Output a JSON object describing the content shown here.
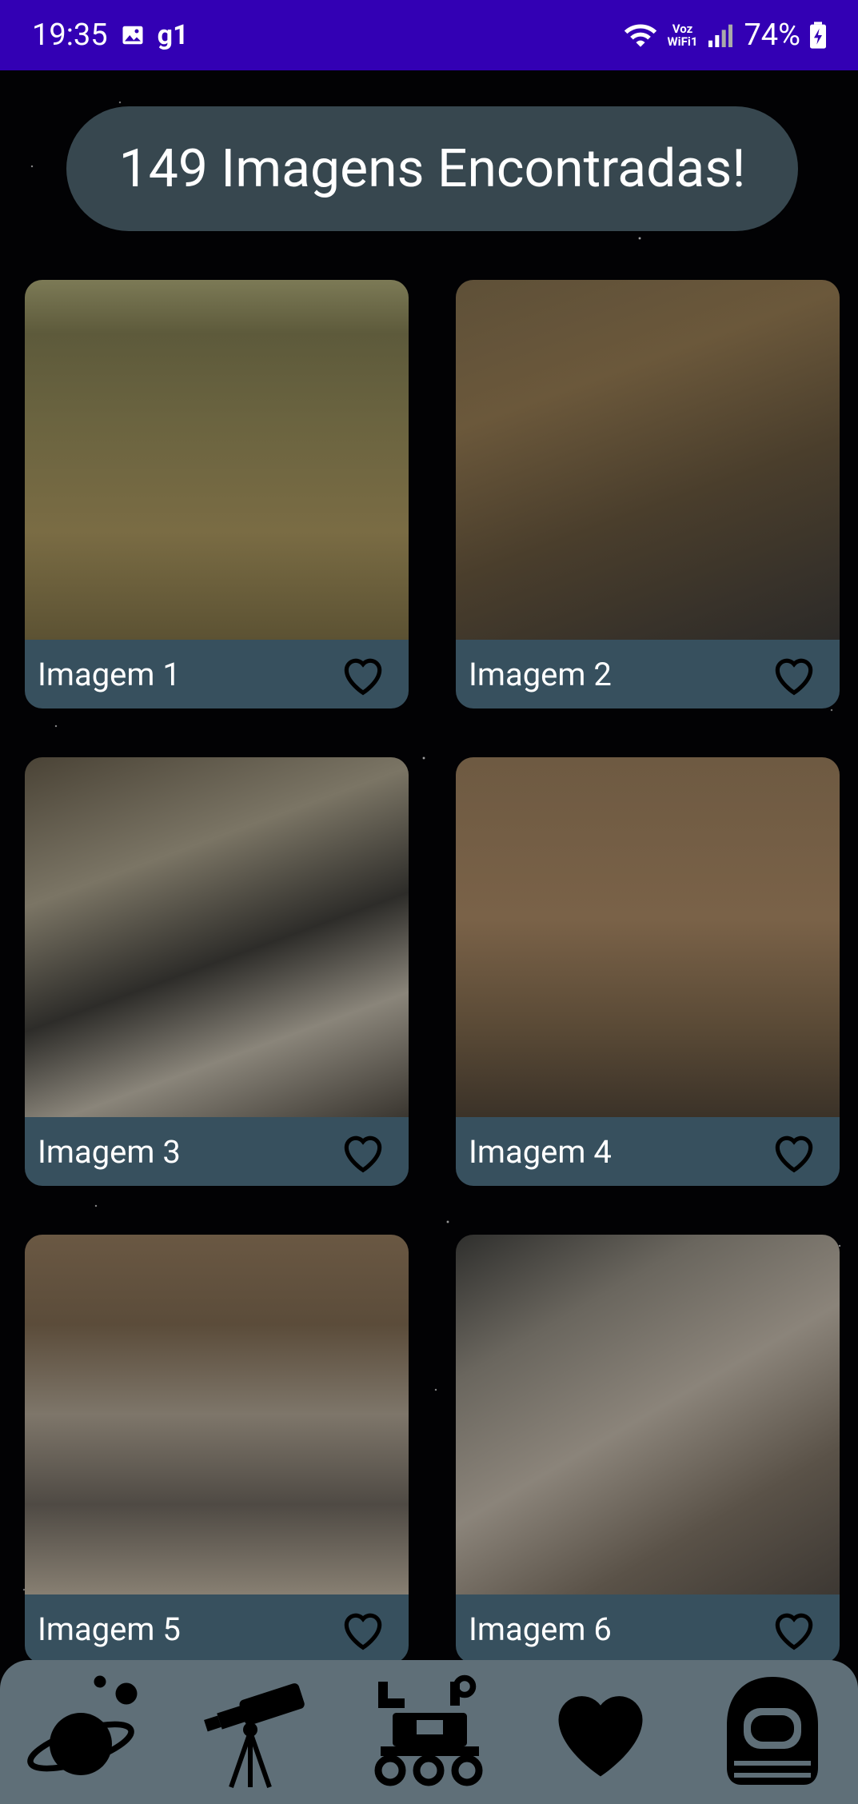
{
  "status_bar": {
    "time": "19:35",
    "carrier": "g1",
    "voz_top": "Voz",
    "voz_bottom": "WiFi1",
    "battery": "74%"
  },
  "title": "149 Imagens Encontradas!",
  "cards": [
    {
      "label": "Imagem 1"
    },
    {
      "label": "Imagem 2"
    },
    {
      "label": "Imagem 3"
    },
    {
      "label": "Imagem 4"
    },
    {
      "label": "Imagem 5"
    },
    {
      "label": "Imagem 6"
    }
  ],
  "nav": [
    {
      "icon": "planet-icon"
    },
    {
      "icon": "telescope-icon"
    },
    {
      "icon": "rover-icon"
    },
    {
      "icon": "heart-icon"
    },
    {
      "icon": "astronaut-helmet-icon"
    }
  ],
  "colors": {
    "status_bar": "#3300b4",
    "pill": "#37474f",
    "card_bar": "#37505e",
    "bottom_nav": "#5f6f78"
  }
}
